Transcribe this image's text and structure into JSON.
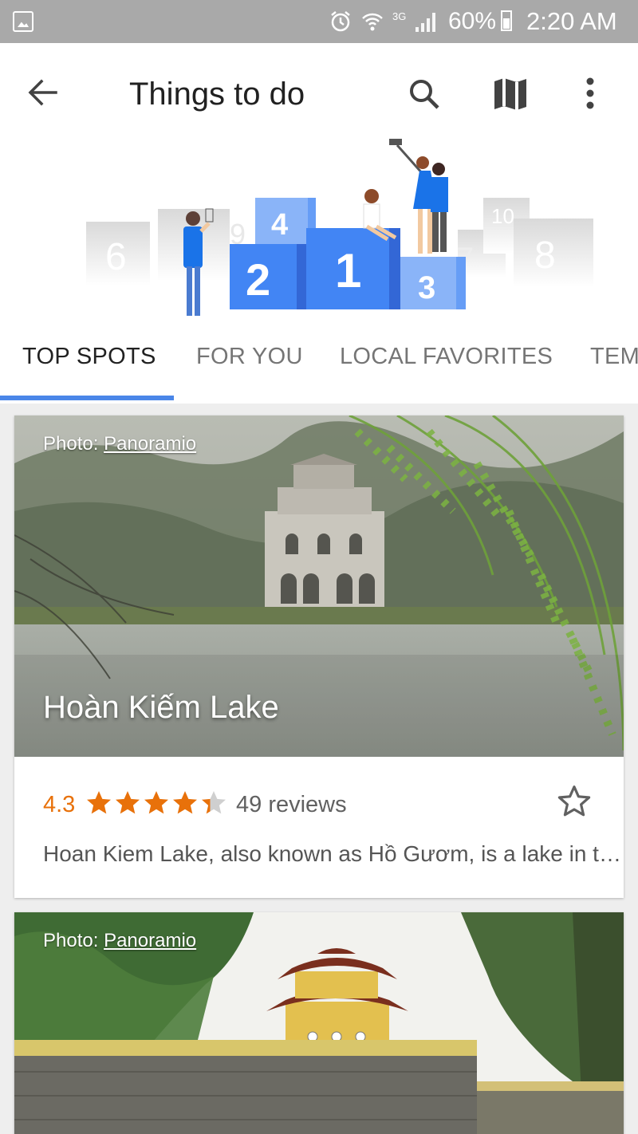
{
  "status_bar": {
    "battery": "60%",
    "time": "2:20 AM",
    "network": "3G",
    "icons": [
      "image-icon",
      "alarm-icon",
      "wifi-icon",
      "signal-icon",
      "battery-icon"
    ]
  },
  "header": {
    "title": "Things to do",
    "icons": [
      "back-arrow-icon",
      "search-icon",
      "map-icon",
      "more-vert-icon"
    ]
  },
  "illustration": {
    "podium_numbers": [
      "2",
      "1",
      "3",
      "4"
    ],
    "background_numbers": [
      "6",
      "9",
      "7",
      "10",
      "8"
    ]
  },
  "tabs": [
    {
      "label": "TOP SPOTS",
      "active": true
    },
    {
      "label": "FOR YOU",
      "active": false
    },
    {
      "label": "LOCAL FAVORITES",
      "active": false
    },
    {
      "label": "TEM",
      "active": false
    }
  ],
  "cards": [
    {
      "photo_credit_prefix": "Photo: ",
      "photo_credit_link": "Panoramio",
      "name": "Hoàn Kiếm Lake",
      "rating": "4.3",
      "rating_value": 4.3,
      "reviews": "49 reviews",
      "description": "Hoan Kiem Lake, also known as Hồ Gươm, is a lake in the historical center of Hanoi"
    },
    {
      "photo_credit_prefix": "Photo: ",
      "photo_credit_link": "Panoramio"
    }
  ],
  "colors": {
    "status_bar": "#a9a9a9",
    "accent_blue": "#4a86e8",
    "rating_orange": "#e8710a"
  }
}
